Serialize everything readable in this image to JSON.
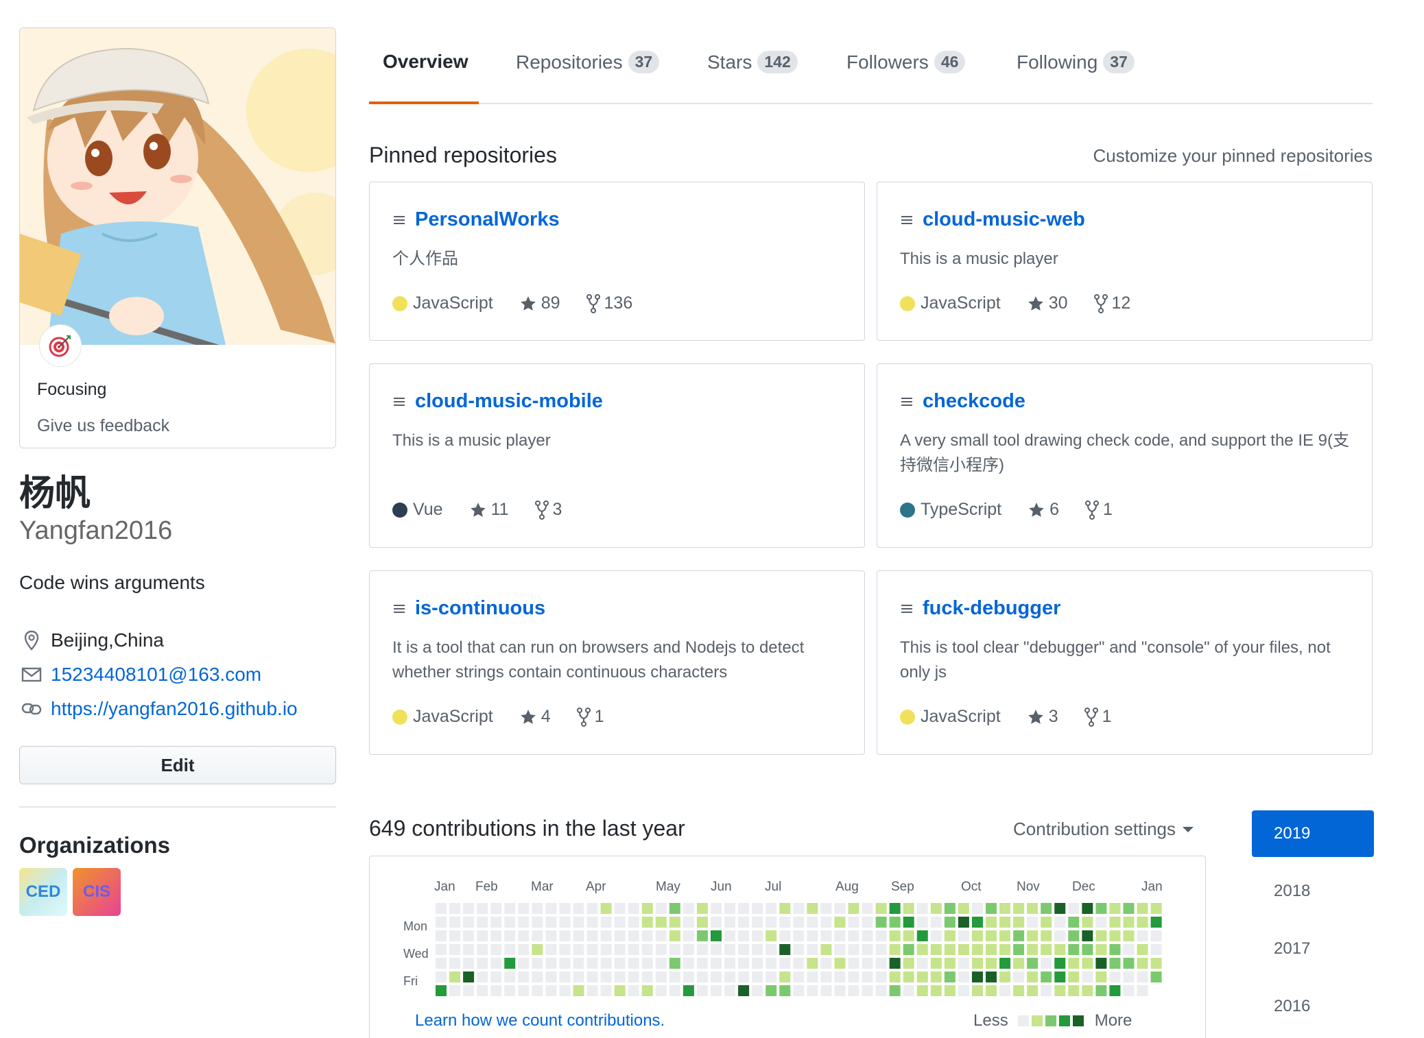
{
  "sidebar": {
    "status_text": "Focusing",
    "feedback": "Give us feedback",
    "name": "杨帆",
    "login": "Yangfan2016",
    "bio": "Code wins arguments",
    "location": "Beijing,China",
    "email": "15234408101@163.com",
    "website": "https://yangfan2016.github.io",
    "edit_label": "Edit",
    "organizations_title": "Organizations",
    "organizations": [
      "CED",
      "CIS"
    ]
  },
  "tabs": [
    {
      "label": "Overview",
      "count": ""
    },
    {
      "label": "Repositories",
      "count": "37"
    },
    {
      "label": "Stars",
      "count": "142"
    },
    {
      "label": "Followers",
      "count": "46"
    },
    {
      "label": "Following",
      "count": "37"
    }
  ],
  "pinned": {
    "title": "Pinned repositories",
    "customize": "Customize your pinned repositories",
    "repos": [
      {
        "name": "PersonalWorks",
        "desc": "个人作品",
        "lang": "JavaScript",
        "lang_color": "#f1e05a",
        "stars": "89",
        "forks": "136"
      },
      {
        "name": "cloud-music-web",
        "desc": "This is a music player",
        "lang": "JavaScript",
        "lang_color": "#f1e05a",
        "stars": "30",
        "forks": "12"
      },
      {
        "name": "cloud-music-mobile",
        "desc": "This is a music player",
        "lang": "Vue",
        "lang_color": "#2c3e50",
        "stars": "11",
        "forks": "3"
      },
      {
        "name": "checkcode",
        "desc": "A very small tool drawing check code, and support the IE 9(支持微信小程序)",
        "lang": "TypeScript",
        "lang_color": "#2b7489",
        "stars": "6",
        "forks": "1"
      },
      {
        "name": "is-continuous",
        "desc": "It is a tool that can run on browsers and Nodejs to detect whether strings contain continuous characters",
        "lang": "JavaScript",
        "lang_color": "#f1e05a",
        "stars": "4",
        "forks": "1"
      },
      {
        "name": "fuck-debugger",
        "desc": "This is tool clear \"debugger\" and \"console\" of your files, not only js",
        "lang": "JavaScript",
        "lang_color": "#f1e05a",
        "stars": "3",
        "forks": "1"
      }
    ]
  },
  "contributions": {
    "title": "649 contributions in the last year",
    "settings": "Contribution settings",
    "months": [
      "Jan",
      "Feb",
      "Mar",
      "Apr",
      "May",
      "Jun",
      "Jul",
      "Aug",
      "Sep",
      "Oct",
      "Nov",
      "Dec",
      "Jan"
    ],
    "weekdays": [
      "Mon",
      "Wed",
      "Fri"
    ],
    "learn": "Learn how we count contributions.",
    "less": "Less",
    "more": "More",
    "colors": [
      "#ebedf0",
      "#c6e48b",
      "#7bc96f",
      "#239a3b",
      "#196127"
    ]
  },
  "years": [
    "2019",
    "2018",
    "2017",
    "2016"
  ]
}
